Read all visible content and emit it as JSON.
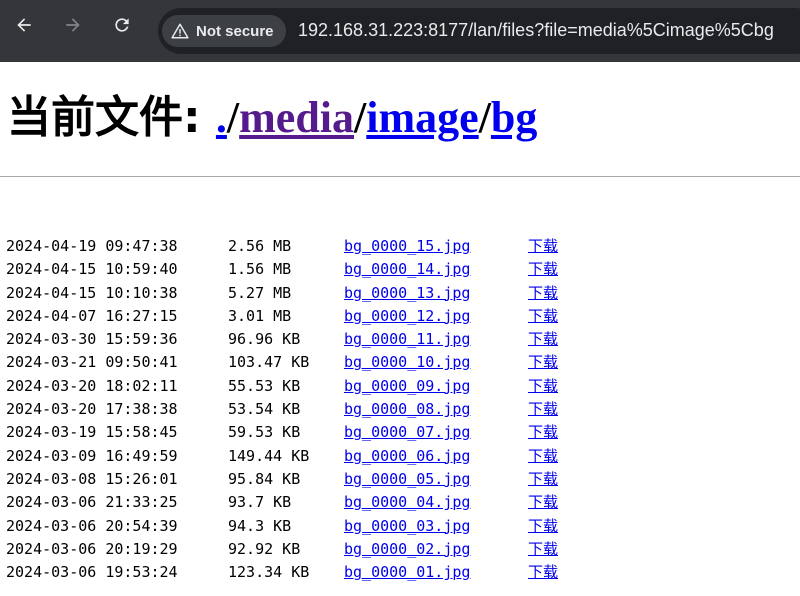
{
  "browser": {
    "security_label": "Not secure",
    "url": "192.168.31.223:8177/lan/files?file=media%5Cimage%5Cbg"
  },
  "heading": {
    "prefix": "当前文件: ",
    "crumbs": [
      ".",
      "media",
      "image",
      "bg"
    ],
    "separator": "/"
  },
  "files": [
    {
      "date": "2024-04-19 09:47:38",
      "size": "2.56 MB",
      "name": "bg_0000_15.jpg",
      "download": "下载"
    },
    {
      "date": "2024-04-15 10:59:40",
      "size": "1.56 MB",
      "name": "bg_0000_14.jpg",
      "download": "下载"
    },
    {
      "date": "2024-04-15 10:10:38",
      "size": "5.27 MB",
      "name": "bg_0000_13.jpg",
      "download": "下载"
    },
    {
      "date": "2024-04-07 16:27:15",
      "size": "3.01 MB",
      "name": "bg_0000_12.jpg",
      "download": "下载"
    },
    {
      "date": "2024-03-30 15:59:36",
      "size": "96.96 KB",
      "name": "bg_0000_11.jpg",
      "download": "下载"
    },
    {
      "date": "2024-03-21 09:50:41",
      "size": "103.47 KB",
      "name": "bg_0000_10.jpg",
      "download": "下载"
    },
    {
      "date": "2024-03-20 18:02:11",
      "size": "55.53 KB",
      "name": "bg_0000_09.jpg",
      "download": "下载"
    },
    {
      "date": "2024-03-20 17:38:38",
      "size": "53.54 KB",
      "name": "bg_0000_08.jpg",
      "download": "下载"
    },
    {
      "date": "2024-03-19 15:58:45",
      "size": "59.53 KB",
      "name": "bg_0000_07.jpg",
      "download": "下载"
    },
    {
      "date": "2024-03-09 16:49:59",
      "size": "149.44 KB",
      "name": "bg_0000_06.jpg",
      "download": "下载"
    },
    {
      "date": "2024-03-08 15:26:01",
      "size": "95.84 KB",
      "name": "bg_0000_05.jpg",
      "download": "下载"
    },
    {
      "date": "2024-03-06 21:33:25",
      "size": "93.7 KB",
      "name": "bg_0000_04.jpg",
      "download": "下载"
    },
    {
      "date": "2024-03-06 20:54:39",
      "size": "94.3 KB",
      "name": "bg_0000_03.jpg",
      "download": "下载"
    },
    {
      "date": "2024-03-06 20:19:29",
      "size": "92.92 KB",
      "name": "bg_0000_02.jpg",
      "download": "下载"
    },
    {
      "date": "2024-03-06 19:53:24",
      "size": "123.34 KB",
      "name": "bg_0000_01.jpg",
      "download": "下载"
    }
  ]
}
